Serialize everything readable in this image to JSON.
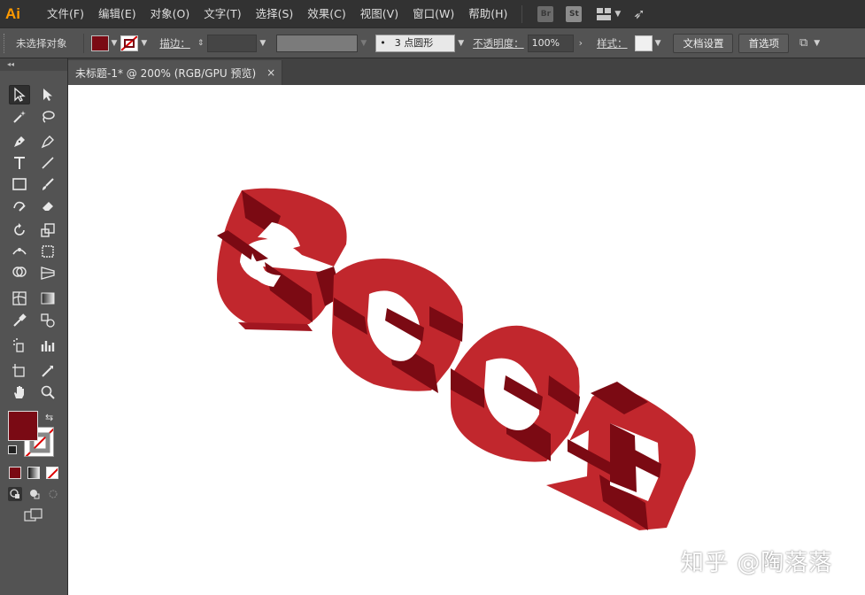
{
  "app": {
    "logo": "Ai"
  },
  "menu": [
    "文件(F)",
    "编辑(E)",
    "对象(O)",
    "文字(T)",
    "选择(S)",
    "效果(C)",
    "视图(V)",
    "窗口(W)",
    "帮助(H)"
  ],
  "menubar_icons": {
    "bridge": "Br",
    "stock": "St"
  },
  "control": {
    "selection_status": "未选择对象",
    "stroke_label": "描边：",
    "brush_value": "3 点圆形",
    "brush_dot": "•",
    "opacity_label": "不透明度：",
    "opacity_value": "100%",
    "style_label": "样式：",
    "doc_setup": "文档设置",
    "preferences": "首选项",
    "fill_color": "#7a0a14"
  },
  "panel_header": "◂◂",
  "document": {
    "tab_title": "未标题-1* @ 200% (RGB/GPU 预览)",
    "tab_close": "×"
  },
  "artwork": {
    "letters": [
      "G",
      "O",
      "O",
      "D"
    ],
    "face_color": "#c1272d",
    "side_color": "#7b0a13"
  },
  "watermark": "知乎 @陶落落"
}
